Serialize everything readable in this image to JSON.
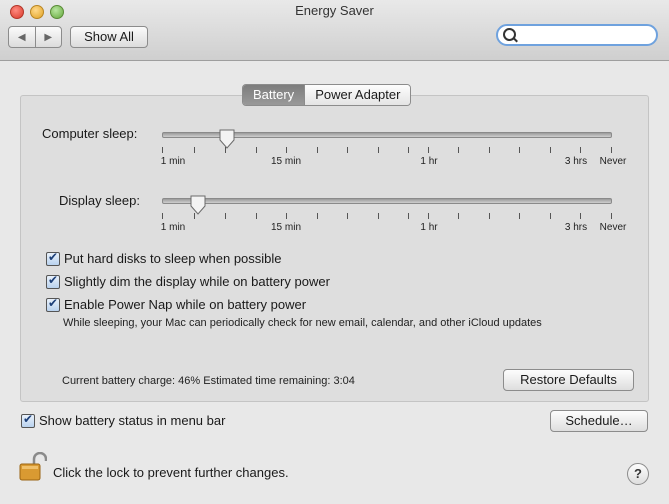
{
  "window": {
    "title": "Energy Saver"
  },
  "toolbar": {
    "back_icon": "◀",
    "forward_icon": "▶",
    "show_all": "Show All",
    "search_placeholder": ""
  },
  "tabs": [
    {
      "label": "Battery",
      "active": true
    },
    {
      "label": "Power Adapter",
      "active": false
    }
  ],
  "computer_sleep": {
    "label": "Computer sleep:",
    "value": "10 min",
    "scale": [
      "1 min",
      "15 min",
      "1 hr",
      "3 hrs",
      "Never"
    ]
  },
  "display_sleep": {
    "label": "Display sleep:",
    "value": "5 min",
    "scale": [
      "1 min",
      "15 min",
      "1 hr",
      "3 hrs",
      "Never"
    ]
  },
  "options": [
    {
      "label": "Put hard disks to sleep when possible",
      "checked": true
    },
    {
      "label": "Slightly dim the display while on battery power",
      "checked": true
    },
    {
      "label": "Enable Power Nap while on battery power",
      "checked": true
    }
  ],
  "power_nap_note": "While sleeping, your Mac can periodically check for new email, calendar, and other iCloud updates",
  "battery_status": "Current battery charge: 46%  Estimated time remaining: 3:04",
  "restore_defaults": "Restore Defaults",
  "show_battery_status": {
    "label": "Show battery status in menu bar",
    "checked": true
  },
  "schedule": "Schedule…",
  "lock_text": "Click the lock to prevent further changes.",
  "help": "?"
}
